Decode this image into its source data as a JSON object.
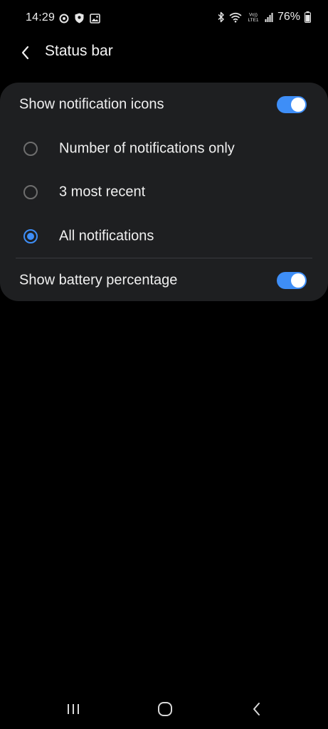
{
  "status_bar": {
    "time": "14:29",
    "left_icons": [
      "circle-dot-icon",
      "shield-icon",
      "image-icon"
    ],
    "right_icons": [
      "bluetooth-icon",
      "wifi-icon",
      "volte-lte-icon",
      "signal-icon",
      "battery-icon"
    ],
    "battery_percent": "76%"
  },
  "header": {
    "title": "Status bar",
    "back_icon": "chevron-left-icon"
  },
  "settings": {
    "show_notification_icons": {
      "label": "Show notification icons",
      "enabled": true
    },
    "notification_options": [
      {
        "label": "Number of notifications only",
        "selected": false
      },
      {
        "label": "3 most recent",
        "selected": false
      },
      {
        "label": "All notifications",
        "selected": true
      }
    ],
    "show_battery_percentage": {
      "label": "Show battery percentage",
      "enabled": true
    }
  },
  "nav_bar": {
    "buttons": [
      "recents-icon",
      "home-icon",
      "back-icon"
    ]
  },
  "colors": {
    "background": "#000000",
    "card": "#1e1f21",
    "accent": "#3e8ef7",
    "text": "#f0f0f0",
    "divider": "#3a3b3e"
  }
}
